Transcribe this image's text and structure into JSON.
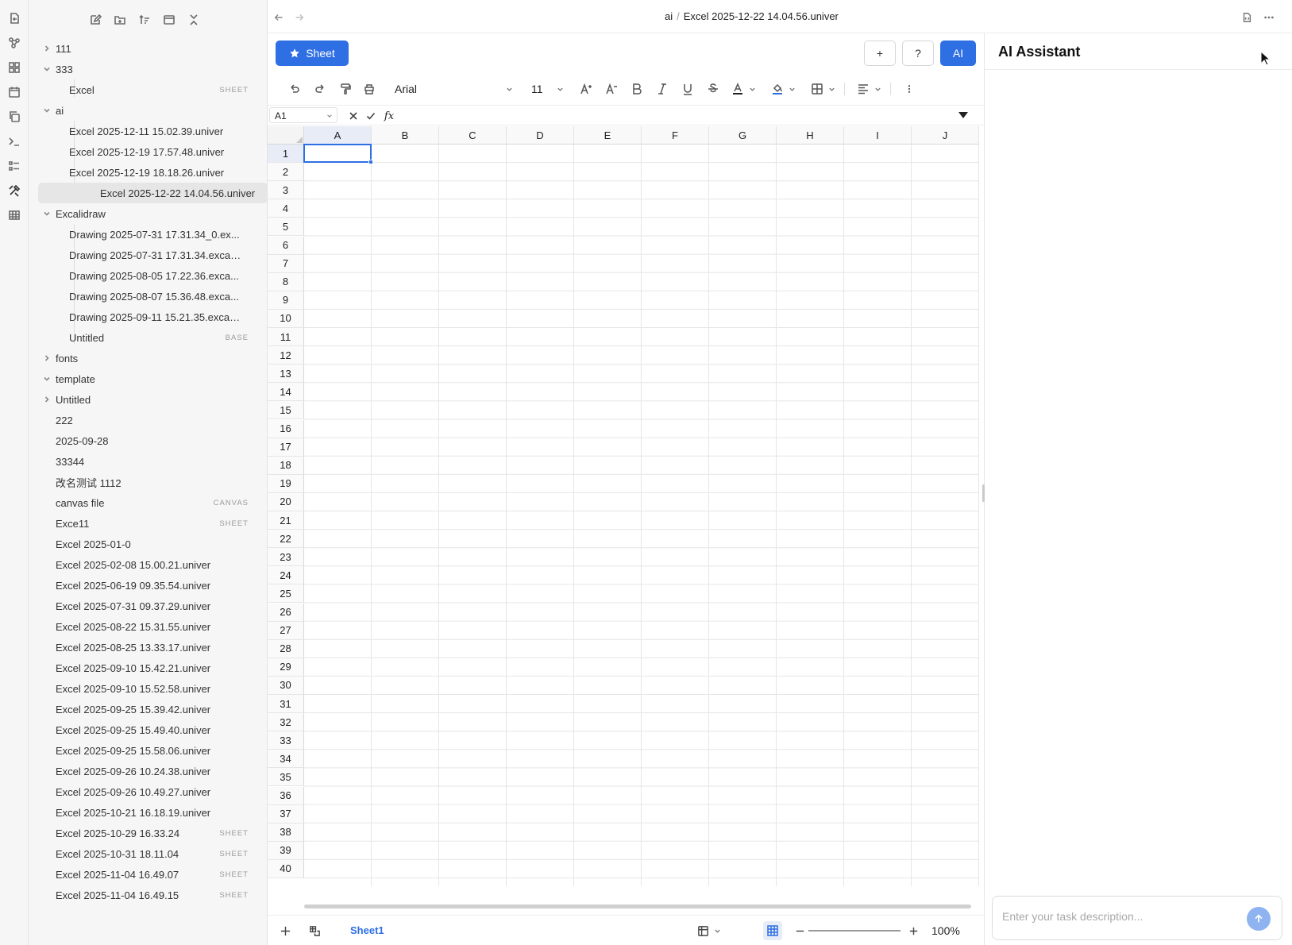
{
  "header": {
    "breadcrumb_folder": "ai",
    "breadcrumb_sep": "/",
    "breadcrumb_file": "Excel 2025-12-22 14.04.56.univer"
  },
  "sidebar": {
    "rows": [
      {
        "label": "111",
        "level": 0,
        "chevron": "right",
        "tag": ""
      },
      {
        "label": "333",
        "level": 0,
        "chevron": "down",
        "tag": ""
      },
      {
        "label": "Excel",
        "level": 1,
        "chevron": "",
        "tag": "SHEET"
      },
      {
        "label": "ai",
        "level": 0,
        "chevron": "down",
        "tag": ""
      },
      {
        "label": "Excel 2025-12-11 15.02.39.univer",
        "level": 1,
        "chevron": "",
        "tag": ""
      },
      {
        "label": "Excel 2025-12-19 17.57.48.univer",
        "level": 1,
        "chevron": "",
        "tag": ""
      },
      {
        "label": "Excel 2025-12-19 18.18.26.univer",
        "level": 1,
        "chevron": "",
        "tag": ""
      },
      {
        "label": "Excel 2025-12-22 14.04.56.univer",
        "level": 1,
        "chevron": "",
        "tag": "",
        "active": true
      },
      {
        "label": "Excalidraw",
        "level": 0,
        "chevron": "down",
        "tag": ""
      },
      {
        "label": "Drawing 2025-07-31 17.31.34_0.ex...",
        "level": 1,
        "chevron": "",
        "tag": ""
      },
      {
        "label": "Drawing 2025-07-31 17.31.34.excali...",
        "level": 1,
        "chevron": "",
        "tag": ""
      },
      {
        "label": "Drawing 2025-08-05 17.22.36.exca...",
        "level": 1,
        "chevron": "",
        "tag": ""
      },
      {
        "label": "Drawing 2025-08-07 15.36.48.exca...",
        "level": 1,
        "chevron": "",
        "tag": ""
      },
      {
        "label": "Drawing 2025-09-11 15.21.35.excali...",
        "level": 1,
        "chevron": "",
        "tag": ""
      },
      {
        "label": "Untitled",
        "level": 1,
        "chevron": "",
        "tag": "BASE"
      },
      {
        "label": "fonts",
        "level": 0,
        "chevron": "right",
        "tag": ""
      },
      {
        "label": "template",
        "level": 0,
        "chevron": "down",
        "tag": ""
      },
      {
        "label": "Untitled",
        "level": 0,
        "chevron": "right",
        "tag": ""
      },
      {
        "label": "222",
        "level": 0,
        "chevron": "",
        "tag": ""
      },
      {
        "label": "2025-09-28",
        "level": 0,
        "chevron": "",
        "tag": ""
      },
      {
        "label": "33344",
        "level": 0,
        "chevron": "",
        "tag": ""
      },
      {
        "label": "改名测试 1112",
        "level": 0,
        "chevron": "",
        "tag": ""
      },
      {
        "label": "canvas file",
        "level": 0,
        "chevron": "",
        "tag": "CANVAS"
      },
      {
        "label": "Exce11",
        "level": 0,
        "chevron": "",
        "tag": "SHEET"
      },
      {
        "label": "Excel 2025-01-0",
        "level": 0,
        "chevron": "",
        "tag": ""
      },
      {
        "label": "Excel 2025-02-08 15.00.21.univer",
        "level": 0,
        "chevron": "",
        "tag": ""
      },
      {
        "label": "Excel 2025-06-19 09.35.54.univer",
        "level": 0,
        "chevron": "",
        "tag": ""
      },
      {
        "label": "Excel 2025-07-31 09.37.29.univer",
        "level": 0,
        "chevron": "",
        "tag": ""
      },
      {
        "label": "Excel 2025-08-22 15.31.55.univer",
        "level": 0,
        "chevron": "",
        "tag": ""
      },
      {
        "label": "Excel 2025-08-25 13.33.17.univer",
        "level": 0,
        "chevron": "",
        "tag": ""
      },
      {
        "label": "Excel 2025-09-10 15.42.21.univer",
        "level": 0,
        "chevron": "",
        "tag": ""
      },
      {
        "label": "Excel 2025-09-10 15.52.58.univer",
        "level": 0,
        "chevron": "",
        "tag": ""
      },
      {
        "label": "Excel 2025-09-25 15.39.42.univer",
        "level": 0,
        "chevron": "",
        "tag": ""
      },
      {
        "label": "Excel 2025-09-25 15.49.40.univer",
        "level": 0,
        "chevron": "",
        "tag": ""
      },
      {
        "label": "Excel 2025-09-25 15.58.06.univer",
        "level": 0,
        "chevron": "",
        "tag": ""
      },
      {
        "label": "Excel 2025-09-26 10.24.38.univer",
        "level": 0,
        "chevron": "",
        "tag": ""
      },
      {
        "label": "Excel 2025-09-26 10.49.27.univer",
        "level": 0,
        "chevron": "",
        "tag": ""
      },
      {
        "label": "Excel 2025-10-21 16.18.19.univer",
        "level": 0,
        "chevron": "",
        "tag": ""
      },
      {
        "label": "Excel 2025-10-29 16.33.24",
        "level": 0,
        "chevron": "",
        "tag": "SHEET"
      },
      {
        "label": "Excel 2025-10-31 18.11.04",
        "level": 0,
        "chevron": "",
        "tag": "SHEET"
      },
      {
        "label": "Excel 2025-11-04 16.49.07",
        "level": 0,
        "chevron": "",
        "tag": "SHEET"
      },
      {
        "label": "Excel 2025-11-04 16.49.15",
        "level": 0,
        "chevron": "",
        "tag": "SHEET"
      }
    ]
  },
  "toolbar": {
    "sheet_button": "Sheet",
    "plus_button": "+",
    "help_button": "?",
    "ai_button": "AI",
    "font_family": "Arial",
    "font_size": "11"
  },
  "formula": {
    "cell_ref": "A1",
    "fx_label": "fx",
    "value": ""
  },
  "grid": {
    "columns": [
      "A",
      "B",
      "C",
      "D",
      "E",
      "F",
      "G",
      "H",
      "I",
      "J"
    ],
    "rows": [
      "1",
      "2",
      "3",
      "4",
      "5",
      "6",
      "7",
      "8",
      "9",
      "10",
      "11",
      "12",
      "13",
      "14",
      "15",
      "16",
      "17",
      "18",
      "19",
      "20",
      "21",
      "22",
      "23",
      "24",
      "25",
      "26",
      "27",
      "28",
      "29",
      "30",
      "31",
      "32",
      "33",
      "34",
      "35",
      "36",
      "37",
      "38",
      "39",
      "40"
    ],
    "selected_cell": "A1"
  },
  "bottom": {
    "sheet_tab": "Sheet1",
    "zoom": "100%"
  },
  "ai_panel": {
    "title": "AI Assistant",
    "input_placeholder": "Enter your task description..."
  },
  "colors": {
    "accent": "#2f6fe4"
  }
}
